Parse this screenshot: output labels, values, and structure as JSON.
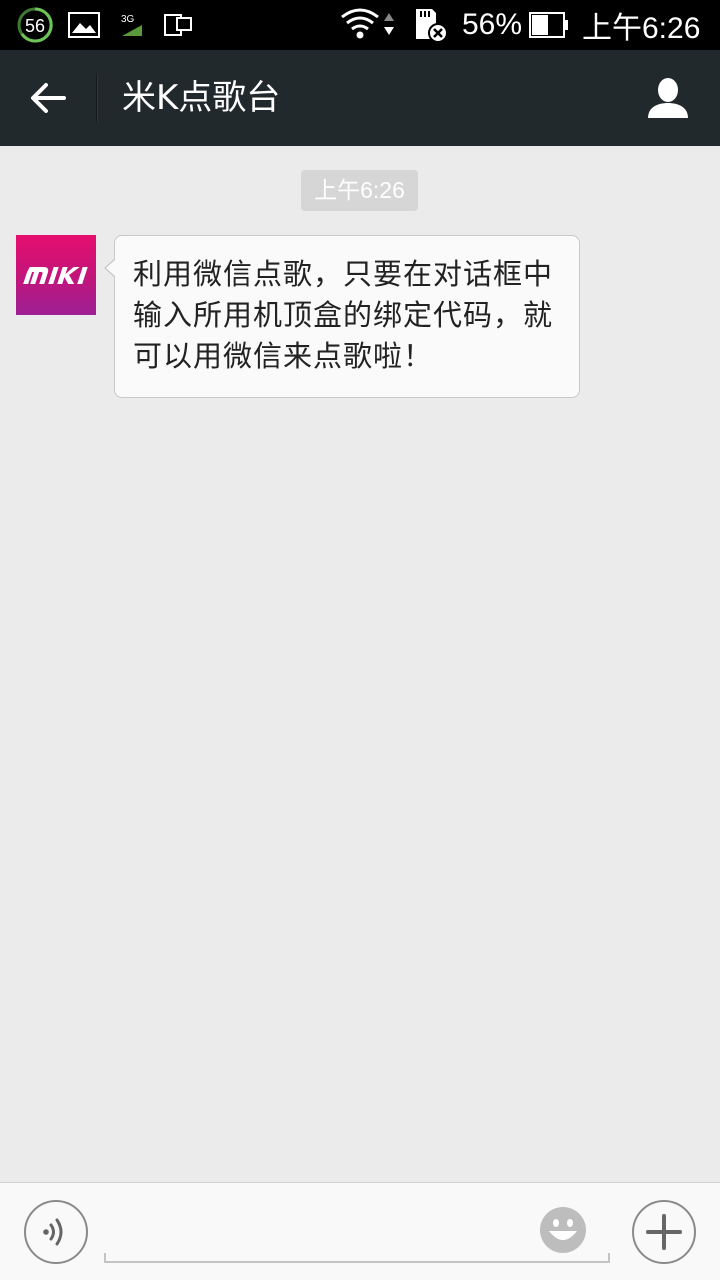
{
  "status_bar": {
    "notification_count": "56",
    "battery_percent": "56%",
    "time": "上午6:26",
    "icons": [
      "notification-count-icon",
      "image-icon",
      "3g-icon",
      "screen-cast-icon",
      "wifi-icon",
      "sd-card-error-icon",
      "battery-icon"
    ]
  },
  "header": {
    "title": "米K点歌台",
    "back_icon": "arrow-left-icon",
    "profile_icon": "person-icon"
  },
  "chat": {
    "timestamp": "上午6:26",
    "messages": [
      {
        "sender_avatar_text": "MIKI",
        "text": "利用微信点歌，只要在对话框中输入所用机顶盒的绑定代码，就可以用微信来点歌啦！"
      }
    ]
  },
  "input_bar": {
    "voice_icon": "voice-icon",
    "emoji_icon": "emoji-icon",
    "plus_icon": "plus-icon",
    "input_value": ""
  },
  "colors": {
    "header_bg": "#22292c",
    "chat_bg": "#ebebeb",
    "avatar_top": "#e60e6e",
    "avatar_bottom": "#9d1f93"
  }
}
